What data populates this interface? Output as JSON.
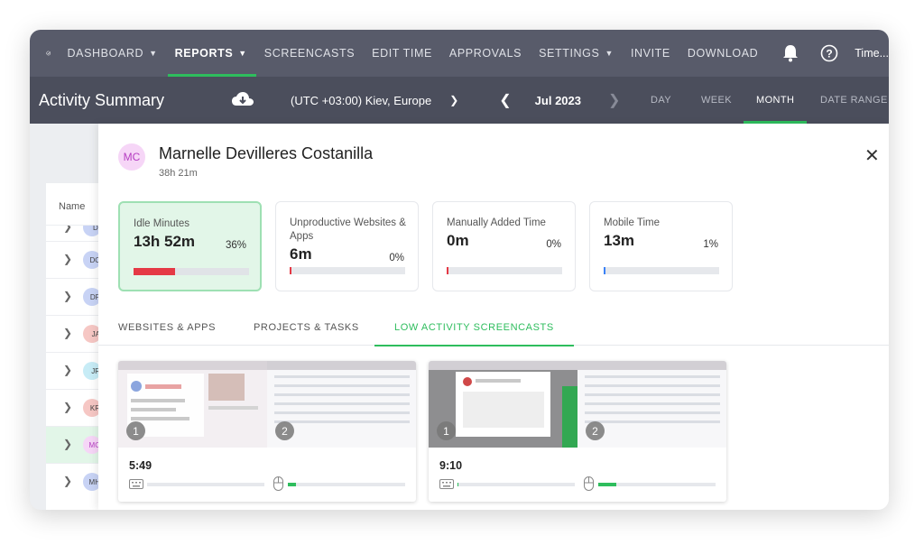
{
  "nav": {
    "items": [
      {
        "label": "DASHBOARD",
        "chevron": true
      },
      {
        "label": "REPORTS",
        "chevron": true,
        "active": true
      },
      {
        "label": "SCREENCASTS"
      },
      {
        "label": "EDIT TIME"
      },
      {
        "label": "APPROVALS"
      },
      {
        "label": "SETTINGS",
        "chevron": true
      },
      {
        "label": "INVITE"
      },
      {
        "label": "DOWNLOAD"
      }
    ],
    "user": "Time..."
  },
  "header": {
    "title": "Activity Summary",
    "timezone": "(UTC +03:00) Kiev, Europe",
    "month": "Jul 2023",
    "ranges": [
      "DAY",
      "WEEK",
      "MONTH",
      "DATE RANGE"
    ],
    "active_range": "MONTH"
  },
  "list": {
    "column": "Name",
    "rows": [
      {
        "initials": "DI",
        "color": "#c8d3f5"
      },
      {
        "initials": "DC",
        "color": "#c8d3f5"
      },
      {
        "initials": "DP",
        "color": "#c8d3f5"
      },
      {
        "initials": "JA",
        "color": "#f6c7c4"
      },
      {
        "initials": "JR",
        "color": "#c7ecf6"
      },
      {
        "initials": "KR",
        "color": "#f6c7c4"
      },
      {
        "initials": "MC",
        "color": "#f6d6f7",
        "selected": true
      },
      {
        "initials": "MH",
        "color": "#c8d3f5"
      }
    ]
  },
  "panel": {
    "initials": "MC",
    "name": "Marnelle Devilleres Costanilla",
    "total": "38h 21m",
    "cards": [
      {
        "label": "Idle Minutes",
        "value": "13h 52m",
        "percent": "36%",
        "fraction": 0.36,
        "color": "#e53945",
        "active": true
      },
      {
        "label": "Unproductive Websites & Apps",
        "value": "6m",
        "percent": "0%",
        "fraction": 0.0,
        "color": "#e53945"
      },
      {
        "label": "Manually Added Time",
        "value": "0m",
        "percent": "0%",
        "fraction": 0.0,
        "color": "#e53945"
      },
      {
        "label": "Mobile Time",
        "value": "13m",
        "percent": "1%",
        "fraction": 0.01,
        "color": "#3b82f6"
      }
    ],
    "tabs": [
      "WEBSITES & APPS",
      "PROJECTS & TASKS",
      "LOW ACTIVITY SCREENCASTS"
    ],
    "active_tab": "LOW ACTIVITY SCREENCASTS",
    "screencasts": [
      {
        "time": "5:49",
        "thumb_numbers": [
          "1",
          "2"
        ],
        "keyboard_fraction": 0.0,
        "mouse_fraction": 0.07
      },
      {
        "time": "9:10",
        "thumb_numbers": [
          "1",
          "2"
        ],
        "keyboard_fraction": 0.01,
        "mouse_fraction": 0.15
      }
    ]
  }
}
